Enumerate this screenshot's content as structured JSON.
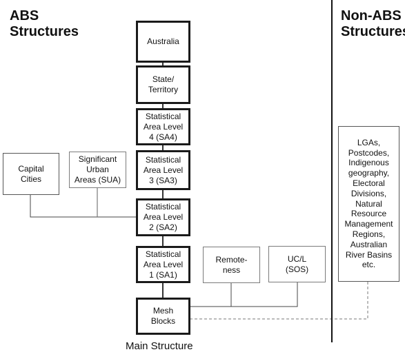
{
  "headings": {
    "abs": "ABS\nStructures",
    "non_abs": "Non-ABS\nStructures"
  },
  "main_structure": {
    "caption": "Main Structure",
    "boxes": [
      {
        "id": "australia",
        "label": "Australia"
      },
      {
        "id": "state-territory",
        "label": "State/\nTerritory"
      },
      {
        "id": "sa4",
        "label": "Statistical\nArea Level\n4 (SA4)"
      },
      {
        "id": "sa3",
        "label": "Statistical\nArea Level\n3 (SA3)"
      },
      {
        "id": "sa2",
        "label": "Statistical\nArea Level\n2 (SA2)"
      },
      {
        "id": "sa1",
        "label": "Statistical\nArea Level\n1 (SA1)"
      },
      {
        "id": "mesh-blocks",
        "label": "Mesh\nBlocks"
      }
    ]
  },
  "other_abs": {
    "capital_cities": "Capital\nCities",
    "sua": "Significant\nUrban\nAreas (SUA)",
    "remoteness": "Remote-\nness",
    "ucl": "UC/L\n(SOS)"
  },
  "non_abs_box": "LGAs,\nPostcodes,\nIndigenous\ngeography,\nElectoral\nDivisions,\nNatural\nResource\nManagement\nRegions,\nAustralian\nRiver Basins\netc.",
  "colors": {
    "main_border": "#1a1a1a",
    "side_border": "#7a7a7a",
    "connector": "#333333",
    "dashed": "#777777"
  }
}
